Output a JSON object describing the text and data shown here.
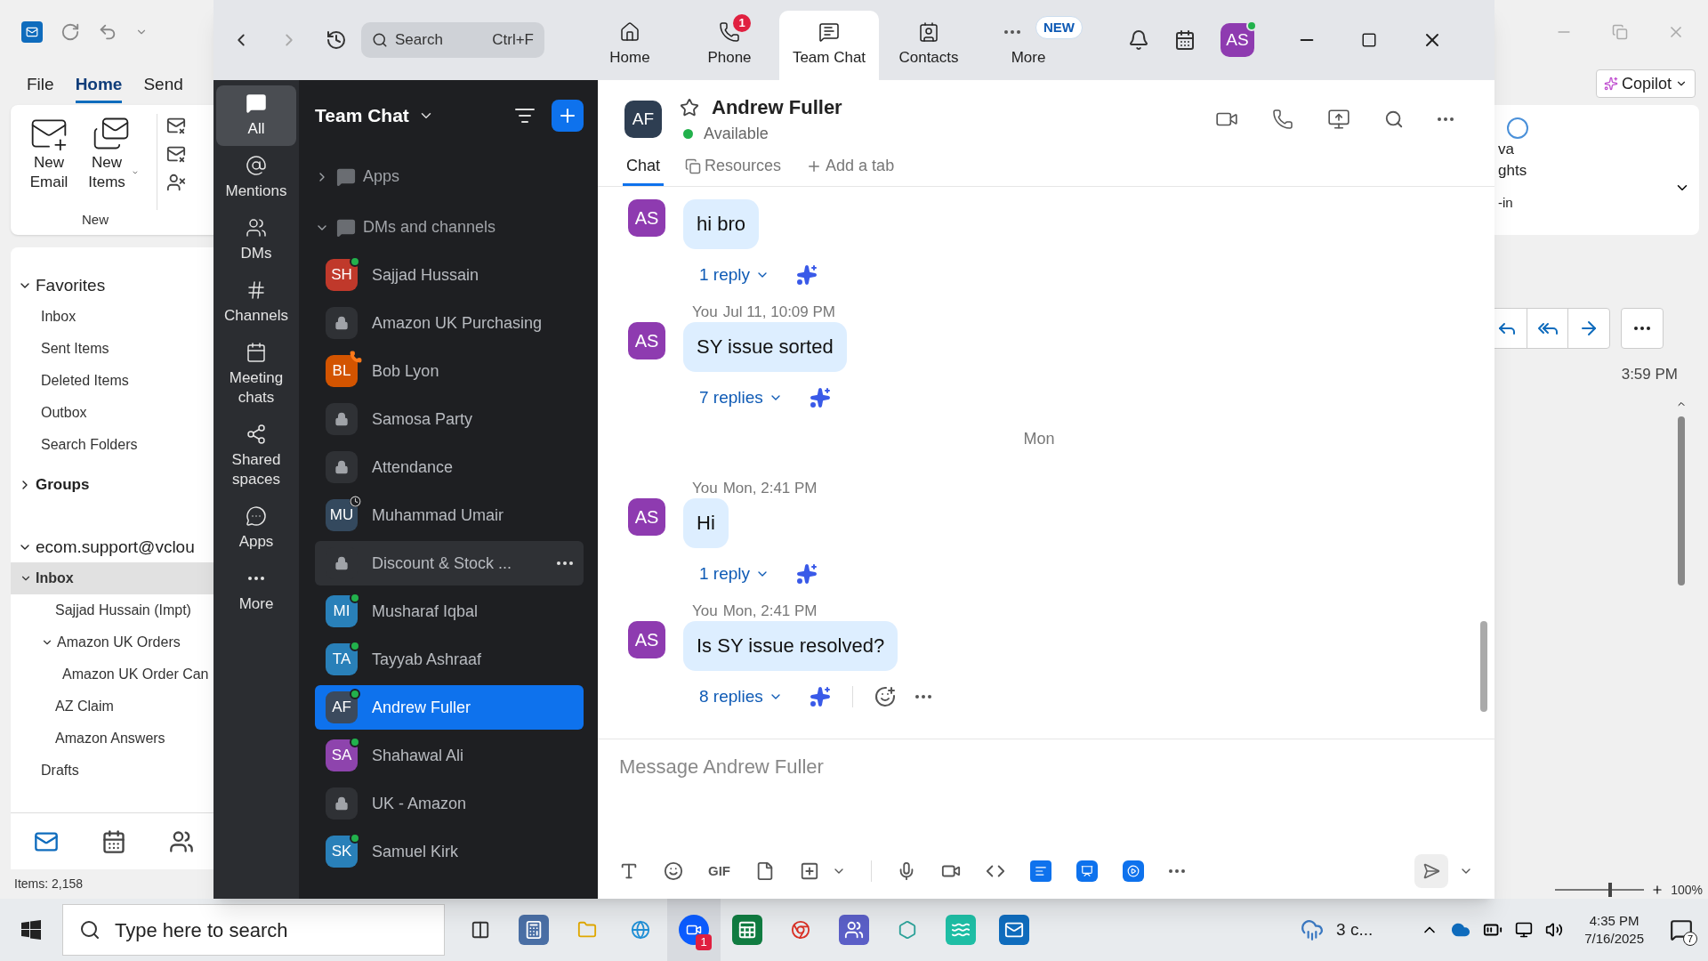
{
  "outlook": {
    "ribbon_tabs": [
      {
        "label": "File",
        "selected": false
      },
      {
        "label": "Home",
        "selected": true
      },
      {
        "label": "Send",
        "selected": false
      }
    ],
    "ribbon_buttons": [
      {
        "label": "New Email",
        "kind": "email"
      },
      {
        "label": "New Items",
        "kind": "items"
      }
    ],
    "ribbon_group": "New",
    "folders": [
      {
        "label": "Favorites",
        "expanded": true,
        "children": [
          {
            "label": "Inbox",
            "selected": false
          },
          {
            "label": "Sent Items",
            "selected": false
          },
          {
            "label": "Deleted Items",
            "selected": false
          },
          {
            "label": "Outbox",
            "selected": false
          },
          {
            "label": "Search Folders",
            "selected": false
          }
        ]
      },
      {
        "label": "Groups",
        "expanded": false
      },
      {
        "label": "ecom.support@vclou",
        "expanded": true,
        "children": [
          {
            "label": "Inbox",
            "selected": true,
            "expanded": true,
            "children": [
              {
                "label": "Sajjad Hussain (Impt)",
                "selected": false
              },
              {
                "label": "Amazon UK Orders",
                "selected": false,
                "expanded": true,
                "children": [
                  {
                    "label": "Amazon UK Order Can",
                    "selected": false
                  }
                ]
              },
              {
                "label": "AZ Claim",
                "selected": false
              },
              {
                "label": "Amazon Answers",
                "selected": false
              }
            ]
          },
          {
            "label": "Drafts",
            "selected": false
          }
        ]
      }
    ],
    "status": "Items: 2,158",
    "copilot": "Copilot",
    "cut_texts": [
      "va",
      "ghts",
      "-in"
    ],
    "time": "3:59 PM",
    "zoom_level": "100%",
    "zoom_slider": {
      "level": 0.62
    }
  },
  "zoom": {
    "search": {
      "placeholder": "Search",
      "shortcut": "Ctrl+F"
    },
    "tabs": [
      {
        "label": "Home",
        "selected": false
      },
      {
        "label": "Phone",
        "selected": false,
        "badge": "1"
      },
      {
        "label": "Team Chat",
        "selected": true
      },
      {
        "label": "Contacts",
        "selected": false
      },
      {
        "label": "More",
        "selected": false,
        "tag": "NEW"
      }
    ],
    "avatar": "AS",
    "rail": [
      {
        "label": "All",
        "selected": true
      },
      {
        "label": "Mentions",
        "selected": false
      },
      {
        "label": "DMs",
        "selected": false
      },
      {
        "label": "Channels",
        "selected": false
      },
      {
        "label": "Meeting chats",
        "selected": false
      },
      {
        "label": "Shared spaces",
        "selected": false
      },
      {
        "label": "Apps",
        "selected": false
      },
      {
        "label": "More",
        "selected": false
      }
    ],
    "list": {
      "title": "Team Chat",
      "sections": [
        {
          "label": "Apps",
          "expanded": false
        },
        {
          "label": "DMs and channels",
          "expanded": true
        }
      ],
      "contacts": [
        {
          "kind": "person",
          "name": "Sajjad Hussain",
          "initials": "SH",
          "color": "#c0392b",
          "online": true,
          "on_call": false,
          "away": false,
          "selected": false,
          "hovered": false
        },
        {
          "kind": "channel",
          "name": "Amazon UK Purchasing",
          "selected": false,
          "hovered": false
        },
        {
          "kind": "person",
          "name": "Bob Lyon",
          "initials": "BL",
          "color": "#d35400",
          "online": false,
          "on_call": true,
          "away": false,
          "selected": false,
          "hovered": false
        },
        {
          "kind": "channel",
          "name": "Samosa Party",
          "selected": false,
          "hovered": false
        },
        {
          "kind": "channel",
          "name": "Attendance",
          "selected": false,
          "hovered": false
        },
        {
          "kind": "person",
          "name": "Muhammad Umair",
          "initials": "MU",
          "color": "#34495e",
          "online": false,
          "on_call": false,
          "away": true,
          "selected": false,
          "hovered": false
        },
        {
          "kind": "channel",
          "name": "Discount & Stock ...",
          "selected": false,
          "hovered": true
        },
        {
          "kind": "person",
          "name": "Musharaf Iqbal",
          "initials": "MI",
          "color": "#2980b9",
          "online": true,
          "on_call": false,
          "away": false,
          "selected": false,
          "hovered": false
        },
        {
          "kind": "person",
          "name": "Tayyab Ashraaf",
          "initials": "TA",
          "color": "#2980b9",
          "online": true,
          "on_call": false,
          "away": false,
          "selected": false,
          "hovered": false
        },
        {
          "kind": "person",
          "name": "Andrew Fuller",
          "initials": "AF",
          "color": "#3b4a5e",
          "online": true,
          "on_call": false,
          "away": false,
          "selected": true,
          "hovered": false
        },
        {
          "kind": "person",
          "name": "Shahawal Ali",
          "initials": "SA",
          "color": "#8e44ad",
          "online": true,
          "on_call": false,
          "away": false,
          "selected": false,
          "hovered": false
        },
        {
          "kind": "channel",
          "name": "UK - Amazon",
          "selected": false,
          "hovered": false
        },
        {
          "kind": "person",
          "name": "Samuel Kirk",
          "initials": "SK",
          "color": "#2980b9",
          "online": true,
          "on_call": false,
          "away": false,
          "selected": false,
          "hovered": false
        }
      ]
    },
    "chat": {
      "name": "Andrew Fuller",
      "initials": "AF",
      "presence": "Available",
      "tabs": [
        {
          "label": "Chat",
          "selected": true,
          "kind": "chat"
        },
        {
          "label": "Resources",
          "selected": false,
          "kind": "resources"
        },
        {
          "label": "Add a tab",
          "selected": false,
          "kind": "add"
        }
      ],
      "items": [
        {
          "kind": "message",
          "avatar": "AS",
          "text": "hi bro",
          "replies": "1 reply",
          "actions": false
        },
        {
          "kind": "message",
          "avatar": "AS",
          "sender": "You",
          "time": "Jul 11, 10:09 PM",
          "text": "SY issue sorted",
          "replies": "7 replies",
          "actions": false
        },
        {
          "kind": "divider",
          "label": "Mon"
        },
        {
          "kind": "message",
          "avatar": "AS",
          "sender": "You",
          "time": "Mon, 2:41 PM",
          "text": "Hi",
          "replies": "1 reply",
          "actions": false
        },
        {
          "kind": "message",
          "avatar": "AS",
          "sender": "You",
          "time": "Mon, 2:41 PM",
          "text": "Is SY issue resolved?",
          "replies": "8 replies",
          "actions": true
        }
      ],
      "compose": {
        "placeholder": "Message Andrew Fuller",
        "gif": "GIF"
      }
    }
  },
  "taskbar": {
    "search_placeholder": "Type here to search",
    "app_badge": "1",
    "weather": "3 c...",
    "time": "4:35 PM",
    "date": "7/16/2025",
    "notifications": "7"
  }
}
